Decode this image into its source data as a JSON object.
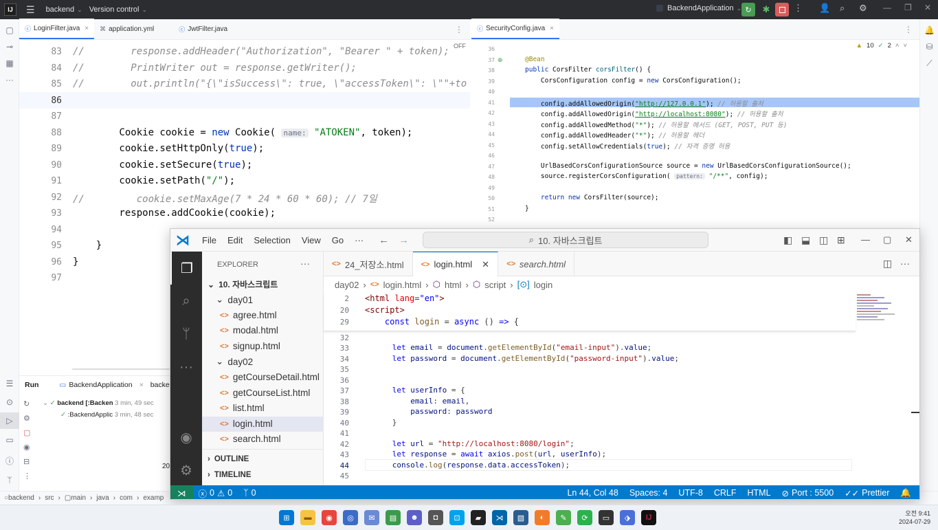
{
  "ij": {
    "project": "backend",
    "vcs": "Version control",
    "run_config": "BackendApplication",
    "left_tabs": [
      "LoginFilter.java",
      "application.yml",
      "JwtFilter.java"
    ],
    "right_tab": "SecurityConfig.java",
    "off_label": "OFF",
    "warnings": "10",
    "checks": "2",
    "left_code": [
      {
        "n": "83"
      },
      {
        "n": "84"
      },
      {
        "n": "85"
      },
      {
        "n": "86"
      },
      {
        "n": "87"
      },
      {
        "n": "88"
      },
      {
        "n": "89"
      },
      {
        "n": "90"
      },
      {
        "n": "91"
      },
      {
        "n": "92"
      },
      {
        "n": "93"
      },
      {
        "n": "94"
      },
      {
        "n": "95"
      },
      {
        "n": "96"
      },
      {
        "n": "97"
      }
    ],
    "right_lines": [
      "36",
      "37",
      "38",
      "39",
      "40",
      "41",
      "42",
      "43",
      "44",
      "45",
      "46",
      "47",
      "48",
      "49",
      "50",
      "51",
      "52"
    ],
    "run": {
      "label": "Run",
      "tab": "BackendApplication",
      "tab2": "backe",
      "item1": "backend [:Backen",
      "item1_time": "3 min, 49 sec",
      "item2": ":BackendApplic",
      "item2_time": "3 min, 48 sec",
      "stub": "20"
    },
    "breadcrumb": [
      "backend",
      "src",
      "main",
      "java",
      "com",
      "examp"
    ]
  },
  "vsc": {
    "menus": [
      "File",
      "Edit",
      "Selection",
      "View",
      "Go",
      "···"
    ],
    "search": "10. 자바스크립트",
    "explorer_label": "EXPLORER",
    "root": "10. 자바스크립트",
    "folders": [
      "day01",
      "day02"
    ],
    "day01_files": [
      "agree.html",
      "modal.html",
      "signup.html"
    ],
    "day02_files": [
      "getCourseDetail.html",
      "getCourseList.html",
      "list.html",
      "login.html",
      "search.html"
    ],
    "outline": "OUTLINE",
    "timeline": "TIMELINE",
    "tabs": [
      "24_저장소.html",
      "login.html",
      "search.html"
    ],
    "breadcrumb": [
      "day02",
      "login.html",
      "html",
      "script",
      "login"
    ],
    "line_numbers": [
      "2",
      "20",
      "29",
      "32",
      "33",
      "34",
      "35",
      "36",
      "37",
      "38",
      "39",
      "40",
      "41",
      "42",
      "43",
      "44",
      "45"
    ],
    "status": {
      "errors": "0",
      "warnings": "0",
      "ports": "0",
      "position": "Ln 44, Col 48",
      "spaces": "Spaces: 4",
      "encoding": "UTF-8",
      "eol": "CRLF",
      "lang": "HTML",
      "port": "Port : 5500",
      "prettier": "Prettier"
    }
  },
  "clock": {
    "time": "오전 9:41",
    "date": "2024-07-29"
  },
  "colors": {
    "vsc_status": "#007acc",
    "ij_title": "#2b2d30",
    "ij_accent": "#3574f0"
  }
}
